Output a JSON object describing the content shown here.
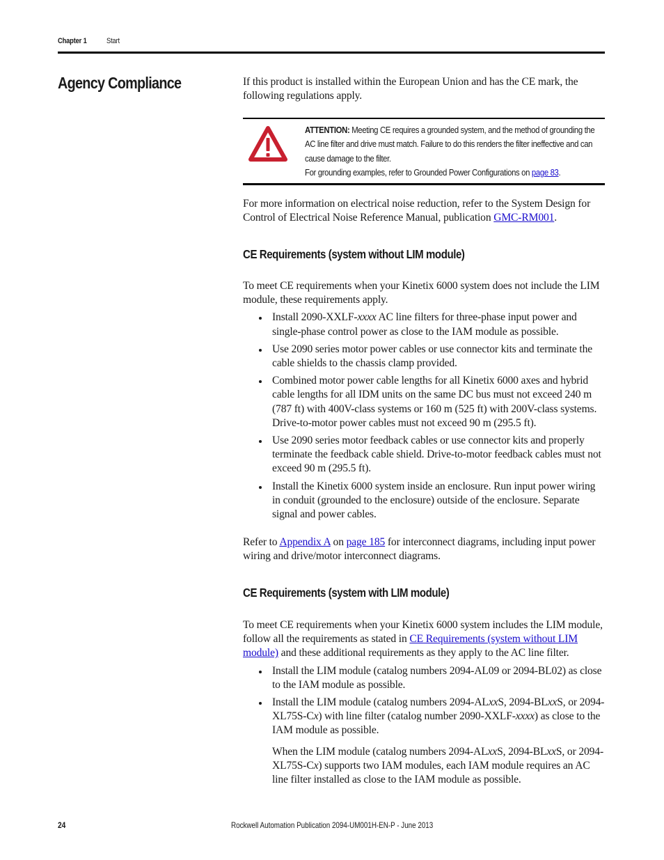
{
  "header": {
    "chapter": "Chapter 1",
    "section": "Start"
  },
  "side_title": "Agency Compliance",
  "intro": "If this product is installed within the European Union and has the CE mark, the following regulations apply.",
  "attention": {
    "icon": "warning-triangle-icon",
    "color": "#c8202f",
    "label": "ATTENTION:",
    "text": " Meeting CE requires a grounded system, and the method of grounding the AC line filter and drive must match. Failure to do this renders the filter ineffective and can cause damage to the filter.",
    "ref_text": "For grounding examples, refer to Grounded Power Configurations on ",
    "ref_link": " page 83",
    "ref_end": "."
  },
  "noise": {
    "text": "For more information on electrical noise reduction, refer to the System Design for Control of Electrical Noise Reference Manual, publication ",
    "link": "GMC-RM001",
    "end": "."
  },
  "section1": {
    "heading": "CE Requirements (system without LIM module)",
    "intro": "To meet CE requirements when your Kinetix 6000 system does not include the LIM module, these requirements apply.",
    "bullets": [
      {
        "pre": "Install 2090-XXLF-",
        "it": "xxxx",
        "post": " AC line filters for three-phase input power and single-phase control power as close to the IAM module as possible."
      },
      {
        "text": "Use 2090 series motor power cables or use connector kits and terminate the cable shields to the chassis clamp provided."
      },
      {
        "text": "Combined motor power cable lengths for all Kinetix 6000 axes and hybrid cable lengths for all IDM units on the same DC bus must not exceed 240 m (787 ft) with 400V-class systems or 160 m (525 ft) with 200V-class systems. Drive-to-motor power cables must not exceed 90 m (295.5 ft)."
      },
      {
        "text": "Use 2090 series motor feedback cables or use connector kits and properly terminate the feedback cable shield. Drive-to-motor feedback cables must not exceed 90 m (295.5 ft)."
      },
      {
        "text": "Install the Kinetix 6000 system inside an enclosure. Run input power wiring in conduit (grounded to the enclosure) outside of the enclosure. Separate signal and power cables."
      }
    ],
    "refer": {
      "pre": "Refer to ",
      "link1": "Appendix A",
      "mid": " on ",
      "link2": "page 185",
      "post": " for interconnect diagrams, including input power wiring and drive/motor interconnect diagrams."
    }
  },
  "section2": {
    "heading": "CE Requirements (system with LIM module)",
    "intro_pre": "To meet CE requirements when your Kinetix 6000 system includes the LIM module, follow all the requirements as stated in ",
    "intro_link": "CE Requirements (system without LIM module)",
    "intro_post": " and these additional requirements as they apply to the AC line filter.",
    "bullet1": "Install the LIM module (catalog numbers 2094-AL09 or 2094-BL02) as close to the IAM module as possible.",
    "bullet2": {
      "a": "Install the LIM module (catalog numbers 2094-AL",
      "b": "xx",
      "c": "S, 2094-BL",
      "d": "xx",
      "e": "S, or 2094-XL75S-C",
      "f": "x",
      "g": ") with line filter (catalog number 2090-XXLF-",
      "h": "xxxx",
      "i": ") as close to the IAM module as possible."
    },
    "note": {
      "a": "When the LIM module (catalog numbers 2094-AL",
      "b": "xx",
      "c": "S, 2094-BL",
      "d": "xx",
      "e": "S, or 2094-XL75S-C",
      "f": "x",
      "g": ") supports two IAM modules, each IAM module requires an AC line filter installed as close to the IAM module as possible."
    }
  },
  "footer": {
    "page_number": "24",
    "publication": "Rockwell Automation Publication 2094-UM001H-EN-P - June 2013"
  }
}
